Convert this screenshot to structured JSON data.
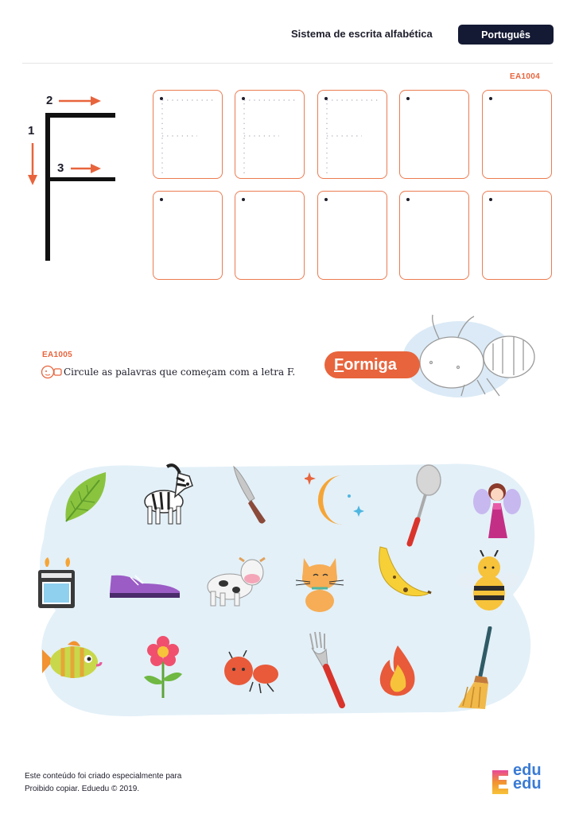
{
  "header": {
    "title": "Sistema de escrita alfabética",
    "subject": "Português"
  },
  "exercise1": {
    "code": "EA1004",
    "letter": "F",
    "stroke_numbers": [
      "1",
      "2",
      "3"
    ]
  },
  "exercise2": {
    "code": "EA1005",
    "instruction": "Circule as palavras que começam com a letra F.",
    "example_word_first": "F",
    "example_word_rest": "ormiga",
    "pictures": [
      "leaf-icon",
      "zebra-icon",
      "knife-icon",
      "moon-icon",
      "spoon-icon",
      "fairy-icon",
      "stove-icon",
      "shoe-icon",
      "cow-icon",
      "cat-icon",
      "banana-icon",
      "bee-icon",
      "fish-icon",
      "flower-icon",
      "ant-icon",
      "fork-icon",
      "fire-icon",
      "broom-icon"
    ]
  },
  "footer": {
    "line1": "Este conteúdo foi criado especialmente para",
    "line2": "Proibido copiar. Eduedu © 2019.",
    "logo_line1": "edu",
    "logo_line2": "edu"
  },
  "colors": {
    "accent": "#e8643c",
    "dark": "#141a33",
    "cloud": "#e3f0f8"
  }
}
